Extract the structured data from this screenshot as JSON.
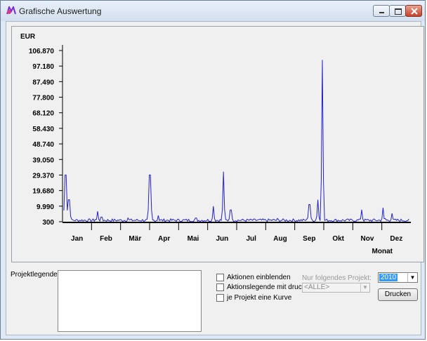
{
  "window": {
    "title": "Grafische Auswertung"
  },
  "chart_data": {
    "type": "line",
    "ylabel": "EUR",
    "xlabel": "Monat",
    "y_ticks": [
      "106.870",
      "97.180",
      "87.490",
      "77.800",
      "68.120",
      "58.430",
      "48.740",
      "39.050",
      "29.370",
      "19.680",
      "9.990",
      "300"
    ],
    "ylim": [
      300,
      106870
    ],
    "categories": [
      "Jan",
      "Feb",
      "Mär",
      "Apr",
      "Mai",
      "Jun",
      "Jul",
      "Aug",
      "Sep",
      "Okt",
      "Nov",
      "Dez"
    ],
    "series": [
      {
        "color": "#2222cc",
        "spikes": [
          {
            "month": 0.1,
            "value": 29370
          },
          {
            "month": 0.22,
            "value": 14000
          },
          {
            "month": 1.2,
            "value": 6800
          },
          {
            "month": 1.35,
            "value": 3200
          },
          {
            "month": 2.25,
            "value": 2600
          },
          {
            "month": 3.0,
            "value": 29370
          },
          {
            "month": 3.3,
            "value": 4200
          },
          {
            "month": 4.6,
            "value": 2600
          },
          {
            "month": 5.2,
            "value": 9990
          },
          {
            "month": 5.55,
            "value": 31500
          },
          {
            "month": 5.8,
            "value": 7600
          },
          {
            "month": 7.4,
            "value": 2400
          },
          {
            "month": 8.5,
            "value": 11000
          },
          {
            "month": 8.8,
            "value": 14000
          },
          {
            "month": 8.95,
            "value": 101000
          },
          {
            "month": 10.3,
            "value": 7800
          },
          {
            "month": 11.05,
            "value": 9000
          },
          {
            "month": 11.35,
            "value": 5500
          }
        ]
      }
    ],
    "grid": false
  },
  "legend": {
    "label": "Projektlegende:"
  },
  "options": {
    "show_actions": "Aktionen einblenden",
    "print_action_legend": "Aktionslegende mit drucken",
    "one_curve_per_project": "je Projekt eine Kurve"
  },
  "project_filter": {
    "label": "Nur folgendes Projekt:",
    "value": "<ALLE>"
  },
  "year_select": {
    "value": "2010"
  },
  "print_button": {
    "label": "Drucken"
  }
}
